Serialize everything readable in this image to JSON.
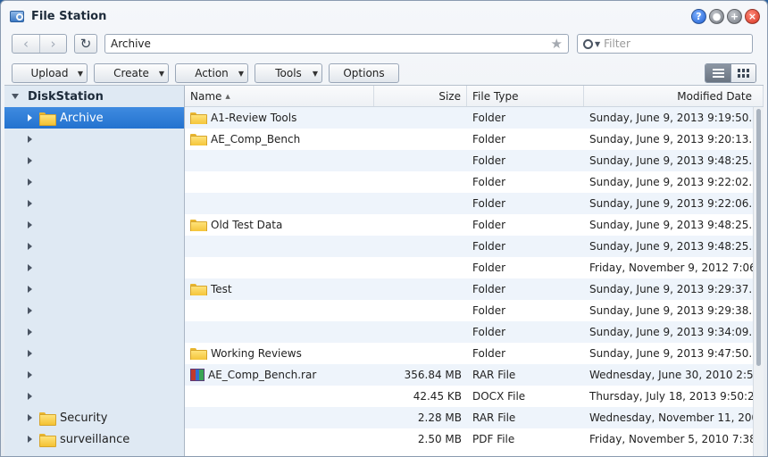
{
  "window": {
    "title": "File Station"
  },
  "navbar": {
    "path": "Archive",
    "search_placeholder": "Filter"
  },
  "toolbar": {
    "upload": "Upload",
    "create": "Create",
    "action": "Action",
    "tools": "Tools",
    "options": "Options"
  },
  "sidebar": {
    "root": "DiskStation",
    "items": [
      {
        "label": "Archive",
        "selected": true,
        "has_folder": true
      },
      {
        "label": ""
      },
      {
        "label": ""
      },
      {
        "label": ""
      },
      {
        "label": ""
      },
      {
        "label": ""
      },
      {
        "label": ""
      },
      {
        "label": ""
      },
      {
        "label": ""
      },
      {
        "label": ""
      },
      {
        "label": ""
      },
      {
        "label": ""
      },
      {
        "label": ""
      },
      {
        "label": ""
      },
      {
        "label": "Security",
        "has_folder": true
      },
      {
        "label": "surveillance",
        "has_folder": true
      }
    ]
  },
  "table": {
    "headers": {
      "name": "Name",
      "size": "Size",
      "type": "File Type",
      "date": "Modified Date"
    },
    "rows": [
      {
        "name": "A1-Review Tools",
        "size": "",
        "type": "Folder",
        "date": "Sunday, June 9, 2013 9:19:50...",
        "icon": "folder"
      },
      {
        "name": "AE_Comp_Bench",
        "size": "",
        "type": "Folder",
        "date": "Sunday, June 9, 2013 9:20:13...",
        "icon": "folder"
      },
      {
        "name": "",
        "size": "",
        "type": "Folder",
        "date": "Sunday, June 9, 2013 9:48:25...",
        "icon": ""
      },
      {
        "name": "",
        "size": "",
        "type": "Folder",
        "date": "Sunday, June 9, 2013 9:22:02...",
        "icon": ""
      },
      {
        "name": "",
        "size": "",
        "type": "Folder",
        "date": "Sunday, June 9, 2013 9:22:06...",
        "icon": ""
      },
      {
        "name": "Old Test Data",
        "size": "",
        "type": "Folder",
        "date": "Sunday, June 9, 2013 9:48:25...",
        "icon": "folder"
      },
      {
        "name": "",
        "size": "",
        "type": "Folder",
        "date": "Sunday, June 9, 2013 9:48:25...",
        "icon": ""
      },
      {
        "name": "",
        "size": "",
        "type": "Folder",
        "date": "Friday, November 9, 2012 7:06...",
        "icon": ""
      },
      {
        "name": "Test",
        "size": "",
        "type": "Folder",
        "date": "Sunday, June 9, 2013 9:29:37...",
        "icon": "folder"
      },
      {
        "name": "",
        "size": "",
        "type": "Folder",
        "date": "Sunday, June 9, 2013 9:29:38...",
        "icon": ""
      },
      {
        "name": "",
        "size": "",
        "type": "Folder",
        "date": "Sunday, June 9, 2013 9:34:09...",
        "icon": ""
      },
      {
        "name": "Working Reviews",
        "size": "",
        "type": "Folder",
        "date": "Sunday, June 9, 2013 9:47:50...",
        "icon": "folder"
      },
      {
        "name": "AE_Comp_Bench.rar",
        "size": "356.84 MB",
        "type": "RAR File",
        "date": "Wednesday, June 30, 2010 2:5...",
        "icon": "rar"
      },
      {
        "name": "",
        "size": "42.45 KB",
        "type": "DOCX File",
        "date": "Thursday, July 18, 2013 9:50:2...",
        "icon": ""
      },
      {
        "name": "",
        "size": "2.28 MB",
        "type": "RAR File",
        "date": "Wednesday, November 11, 200...",
        "icon": ""
      },
      {
        "name": "",
        "size": "2.50 MB",
        "type": "PDF File",
        "date": "Friday, November 5, 2010 7:38...",
        "icon": ""
      }
    ]
  },
  "colors": {
    "selected_row": "#2372cf",
    "sidebar_bg": "#dfe9f3",
    "row_alt": "#eef4fb"
  }
}
